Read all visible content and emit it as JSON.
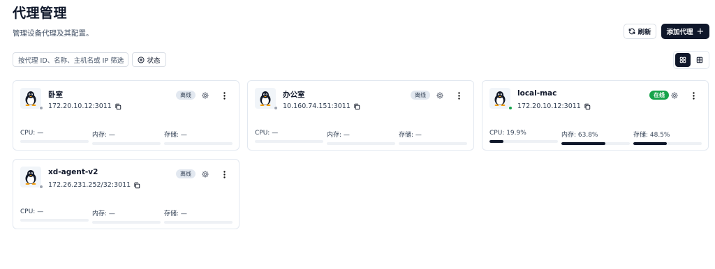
{
  "page": {
    "title": "代理管理",
    "subtitle": "管理设备代理及其配置。"
  },
  "toolbar": {
    "refresh_label": "刷新",
    "refresh_icon": "refresh-icon",
    "add_label": "添加代理",
    "add_icon": "plus-icon"
  },
  "filter": {
    "placeholder": "按代理 ID、名称、主机名或 IP 筛选",
    "status_label": "状态",
    "status_icon": "plus-circle-icon"
  },
  "view": {
    "active": "grid",
    "options": [
      "grid-view-icon",
      "table-view-icon"
    ]
  },
  "colors": {
    "primary": "#0f172a",
    "online": "#16a34a",
    "offline_dot": "#9ca3af",
    "offline_badge_bg": "#e2e8f0",
    "bar_track": "#eef1f5"
  },
  "agents": [
    {
      "name": "卧室",
      "address": "172.20.10.12:3011",
      "status": "离线",
      "online": false,
      "os_icon": "linux-penguin-icon",
      "cpu_label": "CPU: —",
      "mem_label": "内存: —",
      "disk_label": "存储: —",
      "cpu": null,
      "mem": null,
      "disk": null
    },
    {
      "name": "办公室",
      "address": "10.160.74.151:3011",
      "status": "离线",
      "online": false,
      "os_icon": "linux-penguin-icon",
      "cpu_label": "CPU: —",
      "mem_label": "内存: —",
      "disk_label": "存储: —",
      "cpu": null,
      "mem": null,
      "disk": null
    },
    {
      "name": "local-mac",
      "address": "172.20.10.12:3011",
      "status": "在线",
      "online": true,
      "os_icon": "linux-penguin-icon",
      "cpu_label": "CPU: 19.9%",
      "mem_label": "内存: 63.8%",
      "disk_label": "存储: 48.5%",
      "cpu": 19.9,
      "mem": 63.8,
      "disk": 48.5
    },
    {
      "name": "xd-agent-v2",
      "address": "172.26.231.252/32:3011",
      "status": "离线",
      "online": false,
      "os_icon": "linux-penguin-icon",
      "cpu_label": "CPU: —",
      "mem_label": "内存: —",
      "disk_label": "存储: —",
      "cpu": null,
      "mem": null,
      "disk": null
    }
  ]
}
